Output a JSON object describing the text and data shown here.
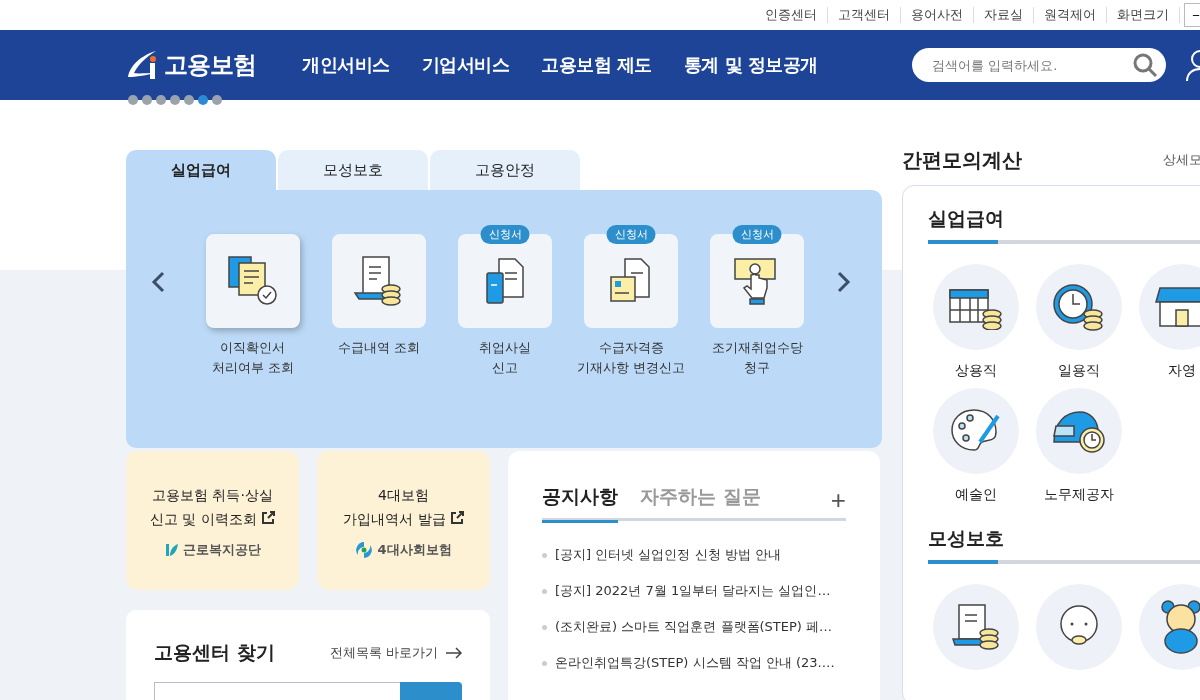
{
  "utility_links": [
    "인증센터",
    "고객센터",
    "용어사전",
    "자료실",
    "원격제어",
    "화면크기"
  ],
  "font_size_button": "−",
  "header": {
    "logo": "고용보험",
    "nav": [
      "개인서비스",
      "기업서비스",
      "고용보험 제도",
      "통계 및 정보공개"
    ],
    "search": {
      "placeholder": "검색어를 입력하세요."
    }
  },
  "slide_dots": [
    {
      "selected": false
    },
    {
      "selected": false
    },
    {
      "selected": false
    },
    {
      "selected": false
    },
    {
      "selected": false
    },
    {
      "selected": true
    },
    {
      "selected": false
    }
  ],
  "service_tabs": [
    {
      "label": "실업급여",
      "selected": true
    },
    {
      "label": "모성보호",
      "selected": false
    },
    {
      "label": "고용안정",
      "selected": false
    }
  ],
  "services": [
    {
      "lines": [
        "이직확인서",
        "처리여부 조회"
      ],
      "selected": true
    },
    {
      "lines": [
        "수급내역 조회"
      ],
      "selected": false
    },
    {
      "lines": [
        "취업사실",
        "신고"
      ],
      "badge": "신청서",
      "selected": false
    },
    {
      "lines": [
        "수급자격증",
        "기재사항 변경신고"
      ],
      "badge": "신청서",
      "selected": false
    },
    {
      "lines": [
        "조기재취업수당",
        "청구"
      ],
      "badge": "신청서",
      "selected": false
    }
  ],
  "quick_links": [
    {
      "lines": [
        "고용보험 취득·상실",
        "신고 및 이력조회"
      ],
      "org": "근로복지공단"
    },
    {
      "lines": [
        "4대보험",
        "가입내역서 발급"
      ],
      "org": "4대사회보험"
    }
  ],
  "center_finder": {
    "title": "고용센터 찾기",
    "link": "전체목록 바로가기"
  },
  "notice": {
    "tabs": [
      {
        "label": "공지사항",
        "selected": true
      },
      {
        "label": "자주하는 질문",
        "selected": false
      }
    ],
    "more": "+",
    "items": [
      "[공지] 인터넷 실업인정 신청 방법 안내",
      "[공지] 2022년 7월 1일부터 달라지는 실업인…",
      "(조치완료) 스마트 직업훈련 플랫폼(STEP) 페…",
      "온라인취업특강(STEP) 시스템 작업 안내 (23.…"
    ]
  },
  "calculator": {
    "title": "간편모의계산",
    "link": "상세모",
    "sections": [
      {
        "title": "실업급여",
        "items": [
          {
            "kind": "tile",
            "label": "상용직"
          },
          {
            "kind": "tile",
            "label": "일용직"
          },
          {
            "kind": "tile",
            "label": "자영"
          },
          {
            "kind": "tile",
            "label": "예술인"
          },
          {
            "kind": "tile",
            "label": "노무제공자"
          }
        ]
      },
      {
        "title": "모성보호",
        "items": [
          {
            "kind": "tile"
          },
          {
            "kind": "tile"
          },
          {
            "kind": "tile"
          }
        ]
      }
    ]
  }
}
